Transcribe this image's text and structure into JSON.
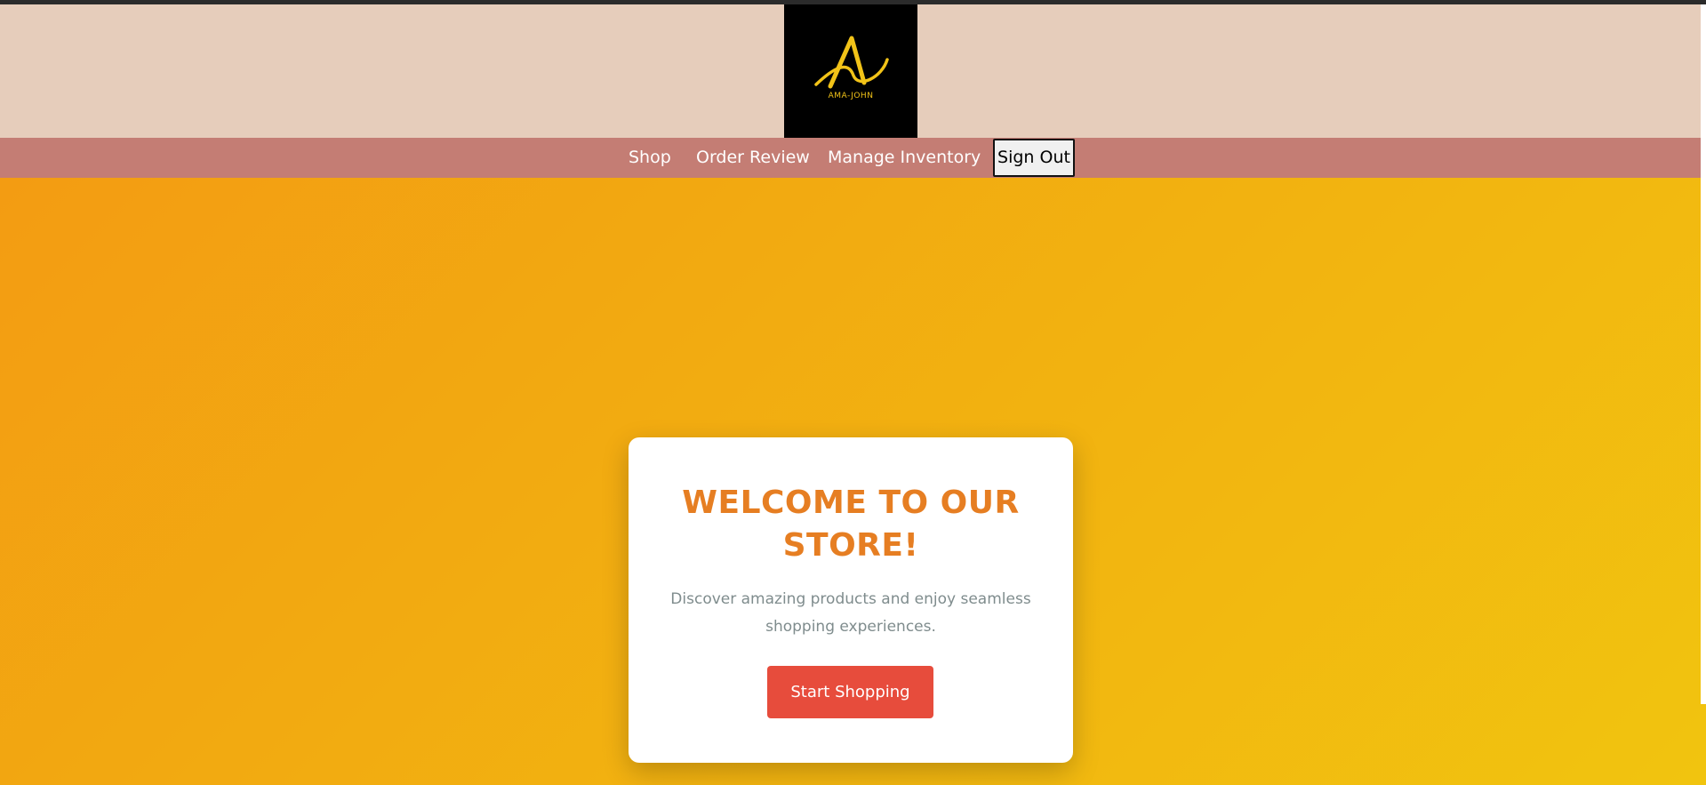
{
  "logo": {
    "text": "AMA-JOHN",
    "icon": "stylized-letter-a-logo",
    "colors": {
      "background": "#000000",
      "mark": "#f2c318"
    }
  },
  "nav": {
    "items": [
      {
        "label": "Shop"
      },
      {
        "label": "Order Review"
      },
      {
        "label": "Manage Inventory"
      }
    ],
    "signout_label": "Sign Out"
  },
  "hero": {
    "title": "WELCOME TO OUR STORE!",
    "description": "Discover amazing products and enjoy seamless shopping experiences.",
    "cta_label": "Start Shopping"
  },
  "colors": {
    "header_bg": "#e6cdbb",
    "nav_bg": "#c47d74",
    "hero_gradient_start": "#f39c12",
    "hero_gradient_end": "#f1c40f",
    "title": "#e67e22",
    "description": "#7f8c8d",
    "cta_bg": "#e74c3c"
  }
}
